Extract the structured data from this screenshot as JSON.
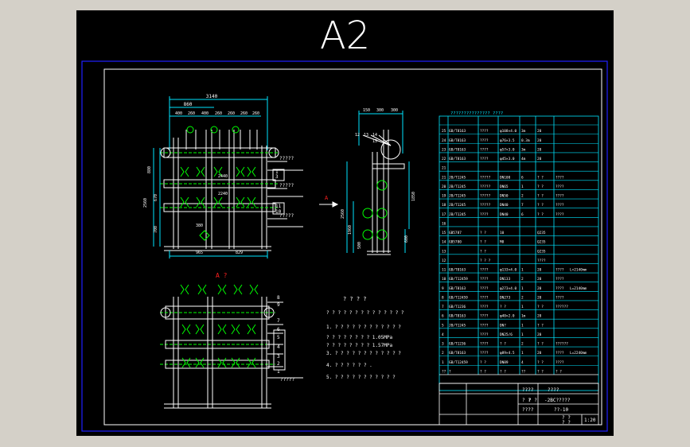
{
  "sheet": {
    "size_label": "A2"
  },
  "front_view": {
    "dim_top_total": "3140",
    "dim_top_2": "860",
    "dim_top_parts": [
      "400",
      "260",
      "400",
      "260",
      "260",
      "260",
      "260"
    ],
    "dim_v_1": "880",
    "dim_v_2": "2560",
    "dim_v_3": "670",
    "dim_v_4": "700",
    "dim_mid_1": "2440",
    "dim_mid_2": "2240",
    "dim_small": "380",
    "dim_bottom_1": "965",
    "dim_bottom_2": "829",
    "callouts": [
      "3",
      "11",
      "10",
      "1"
    ],
    "callout_texts": [
      "?????",
      "?????",
      "?????"
    ]
  },
  "side_view": {
    "dim_top": [
      "150",
      "300",
      "300"
    ],
    "leaders": [
      "12",
      "13",
      "14",
      "15"
    ],
    "dim_v": [
      "2560",
      "1960",
      "1850",
      "600",
      "500"
    ],
    "arrow_label": "A"
  },
  "view_a": {
    "title": "A ?",
    "callouts": [
      "8",
      "9",
      "7",
      "6",
      "5",
      "4",
      "3",
      "2",
      "1"
    ],
    "callout_text": "?????"
  },
  "tech_notes": {
    "title": "? ? ? ?",
    "lines": [
      "? ? ? ? ? ? ? ? ? ? ? ? ? ?",
      "1. ? ? ? ? ? ? ? ? ? ? ? ?",
      "   ? ? ? ? ? ? ? ? 1.05MPa",
      "   ? ? ? ? ? ? ? ? 1.57MPa",
      "3. ? ? ? ? ? ? ? ? ? ? ? ?",
      "4. ? ? ? ? ? ? .",
      "5. ? ? ? ? ? ? ? ? ? ? ?"
    ]
  },
  "parts_table": {
    "header": "??????????????? ????",
    "rows": [
      [
        "25",
        "GB/T8163",
        "????",
        "φ108×4.0",
        "3m",
        "20",
        "",
        ""
      ],
      [
        "24",
        "GB/T8163",
        "????",
        "φ76×3.5",
        "0.3m",
        "20",
        "",
        ""
      ],
      [
        "23",
        "GB/T8163",
        "????",
        "φ57×3.0",
        "3m",
        "20",
        "",
        ""
      ],
      [
        "22",
        "GB/T8163",
        "????",
        "φ45×3.0",
        "4m",
        "20",
        "",
        ""
      ],
      [
        "21",
        "",
        "",
        "",
        "",
        "",
        "",
        ""
      ],
      [
        "21",
        "JB/T1245",
        "?????",
        "DN100",
        "6",
        "? ?",
        "????",
        ""
      ],
      [
        "20",
        "JB/T1245",
        "?????",
        "DN65",
        "1",
        "? ?",
        "????",
        ""
      ],
      [
        "19",
        "JB/T1245",
        "?????",
        "DN50",
        "2",
        "? ?",
        "????",
        ""
      ],
      [
        "18",
        "JB/T1245",
        "?????",
        "DN40",
        "7",
        "? ?",
        "????",
        ""
      ],
      [
        "17",
        "JB/T1245",
        "????",
        "DN40",
        "6",
        "? ?",
        "????",
        ""
      ],
      [
        "16",
        "",
        "",
        "",
        "",
        "",
        "",
        ""
      ],
      [
        "15",
        "GB5787",
        "? ?",
        "10",
        "",
        "Q235",
        "",
        ""
      ],
      [
        "14",
        "GB5780",
        "? ?",
        "M8",
        "",
        "Q235",
        "",
        ""
      ],
      [
        "13",
        "",
        "? ?",
        "",
        "",
        "Q235",
        "",
        ""
      ],
      [
        "12",
        "",
        "? ? ?",
        "",
        "",
        "????",
        "",
        ""
      ],
      [
        "11",
        "GB/T8163",
        "????",
        "φ133×4.0",
        "1",
        "20",
        "????",
        "L=2140mm"
      ],
      [
        "10",
        "GB/T12459",
        "????",
        "DN133",
        "2",
        "20",
        "????",
        ""
      ],
      [
        "9",
        "GB/T8163",
        "????",
        "φ273×4.0",
        "1",
        "20",
        "????",
        "L=2140mm"
      ],
      [
        "8",
        "GB/T12459",
        "????",
        "DN273",
        "2",
        "20",
        "????",
        ""
      ],
      [
        "7",
        "GB/T1236",
        "????",
        "? ?",
        "1",
        "? ?",
        "??????",
        ""
      ],
      [
        "6",
        "GB/T8163",
        "????",
        "φ40×2.0",
        "1m",
        "20",
        "",
        ""
      ],
      [
        "5",
        "JB/T1245",
        "????",
        "DN?",
        "1",
        "? ?",
        "",
        ""
      ],
      [
        "4",
        "",
        "????",
        "DN25/6",
        "1",
        "20",
        "",
        ""
      ],
      [
        "3",
        "GB/T1236",
        "????",
        "? ?",
        "2",
        "? ?",
        "??????",
        ""
      ],
      [
        "2",
        "GB/T8163",
        "????",
        "φ89×4.5",
        "1",
        "20",
        "????",
        "L=2240mm"
      ],
      [
        "1",
        "GB/T12459",
        "? ?",
        "DN89",
        "4",
        "? ?",
        "????",
        ""
      ],
      [
        "??",
        "?",
        "? ?",
        "? ?",
        "??",
        "? ?",
        "? ?",
        ""
      ]
    ],
    "title_block": {
      "a": "????",
      "b": "????",
      "c": "? ?",
      "d": "? ?",
      "e": "-2BC?????",
      "f": "????",
      "g": "??-10",
      "h": "? ?",
      "i": "? ?",
      "j": "1:20"
    }
  },
  "colors": {
    "line": "#ffffff",
    "annotation": "#00e5ff",
    "valve": "#00ff00",
    "section": "#ff2020",
    "border": "#2020ff"
  }
}
